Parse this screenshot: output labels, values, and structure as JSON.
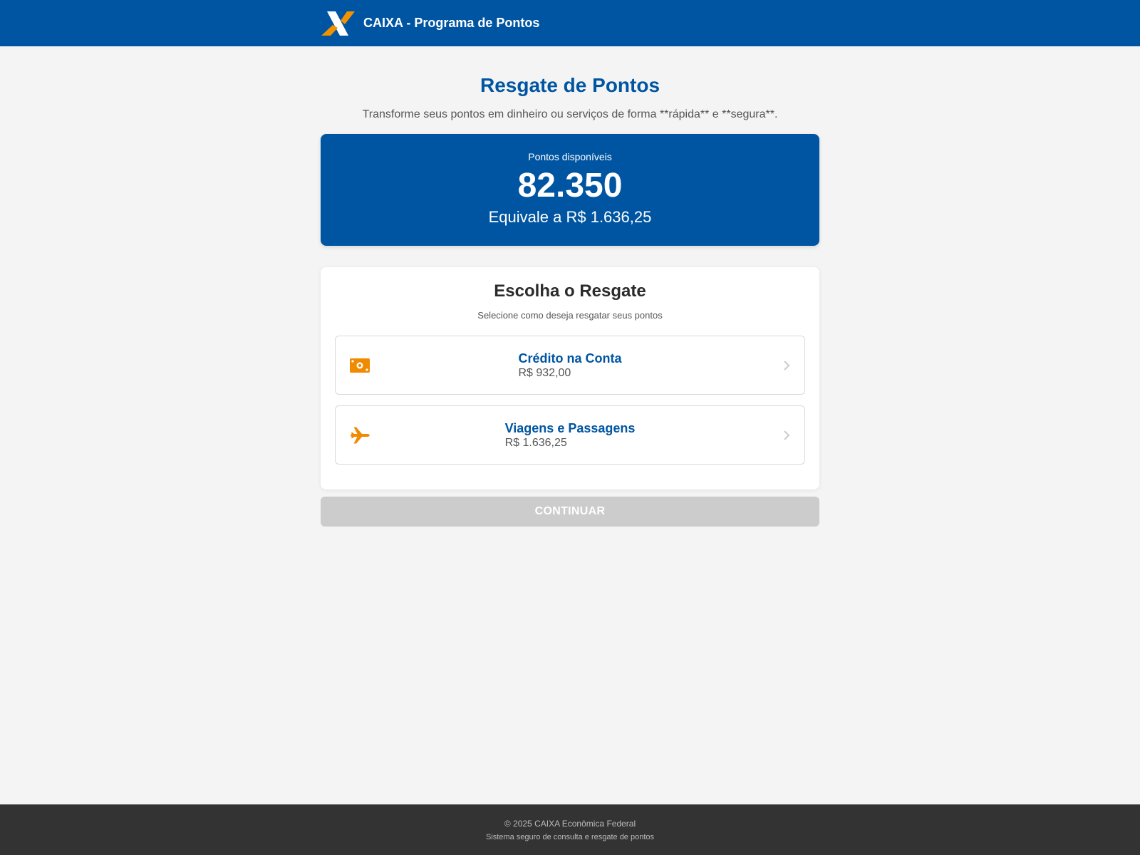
{
  "header": {
    "app_title": "CAIXA - Programa de Pontos",
    "logo_icon": "caixa-x-logo",
    "bg_color": "#0055a2",
    "logo_orange": "#f39200"
  },
  "main": {
    "title": "Resgate de Pontos",
    "subtitle": "Transforme seus pontos em dinheiro ou serviços de forma **rápida** e **segura**."
  },
  "points": {
    "label": "Pontos disponíveis",
    "value": "82.350",
    "equivalent": "Equivale a R$ 1.636,25"
  },
  "redeem": {
    "title": "Escolha o Resgate",
    "subtitle": "Selecione como deseja resgatar seus pontos",
    "options": [
      {
        "name": "Crédito na Conta",
        "value": "R$ 932,00",
        "icon": "money-bill-icon"
      },
      {
        "name": "Viagens e Passagens",
        "value": "R$ 1.636,25",
        "icon": "plane-icon"
      }
    ]
  },
  "actions": {
    "continue_label": "CONTINUAR",
    "continue_disabled": true
  },
  "footer": {
    "copyright": "© 2025 CAIXA Econômica Federal",
    "tagline": "Sistema seguro de consulta e resgate de pontos"
  }
}
